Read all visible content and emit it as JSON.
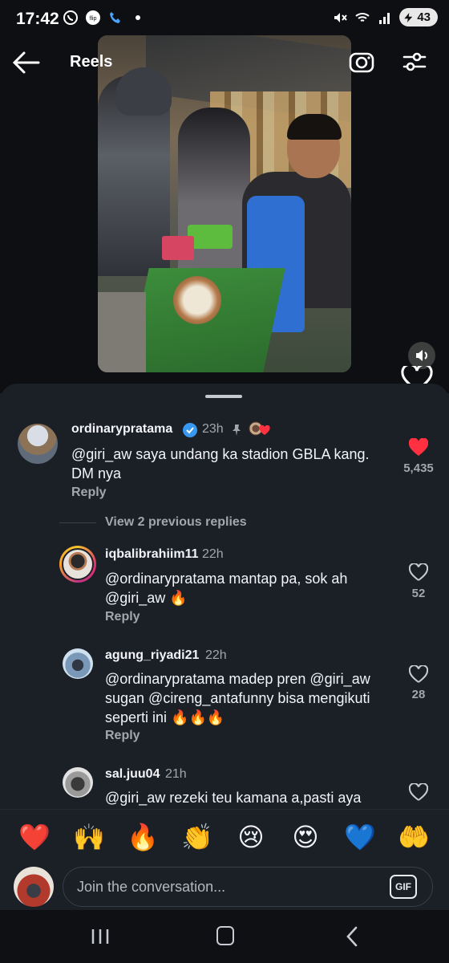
{
  "status_bar": {
    "time": "17:42",
    "notif_icons": [
      "whatsapp-icon",
      "flip-icon",
      "phone-icon",
      "dot-icon"
    ],
    "sys_icons": [
      "mute-icon",
      "wifi-icon",
      "signal-icon"
    ],
    "battery": "43"
  },
  "header": {
    "title": "Reels",
    "left_icon": "back-arrow-icon",
    "right_icons": [
      "camera-icon",
      "filter-icon"
    ]
  },
  "comments": [
    {
      "username": "ordinarypratama",
      "verified": true,
      "time": "23h",
      "pinned": true,
      "liked_by_creator": true,
      "text": "@giri_aw saya undang ka stadion GBLA kang. DM nya",
      "likes": "5,435",
      "liked": true,
      "reply_label": "Reply"
    },
    {
      "view_previous": "View 2 previous replies"
    },
    {
      "username": "iqbalibrahiim11",
      "time": "22h",
      "text": "@ordinarypratama mantap pa, sok ah @giri_aw 🔥",
      "likes": "52",
      "reply_label": "Reply"
    },
    {
      "username": "agung_riyadi21",
      "time": "22h",
      "text": "@ordinarypratama madep pren @giri_aw  sugan @cireng_antafunny bisa mengikuti seperti ini 🔥🔥🔥",
      "likes": "28",
      "reply_label": "Reply"
    },
    {
      "username": "sal.juu04",
      "time": "21h",
      "text": "@giri_aw rezeki teu kamana a,pasti aya"
    }
  ],
  "emoji_bar": [
    "❤️",
    "🙌",
    "🔥",
    "👏",
    "😢",
    "😍",
    "💙",
    "🤲"
  ],
  "composer": {
    "placeholder": "Join the conversation...",
    "gif_label": "GIF"
  },
  "colors": {
    "background": "#1b1f26",
    "heart_liked": "#ff3040",
    "verified": "#3897f0",
    "muted_text": "#a2a7ae"
  }
}
